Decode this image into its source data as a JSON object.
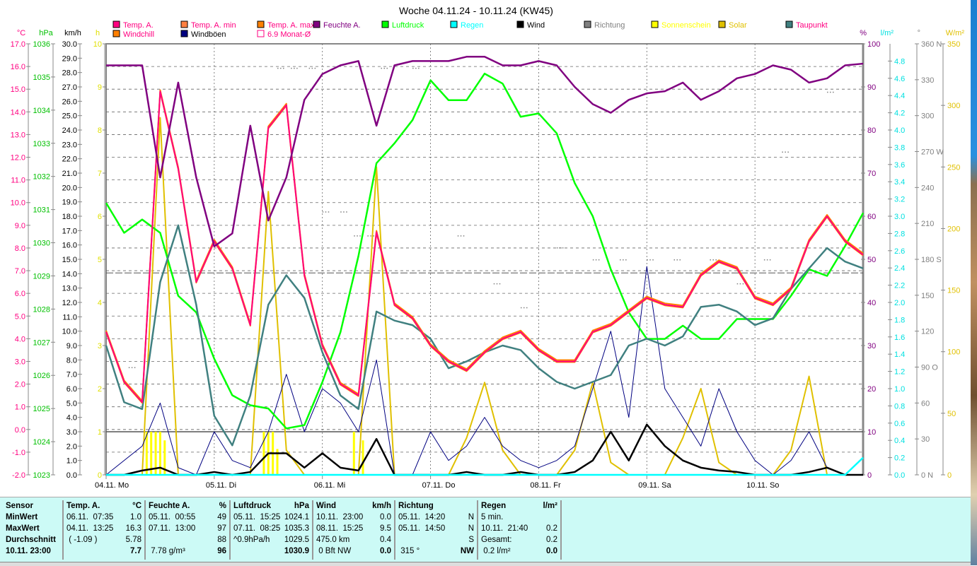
{
  "chart_data": {
    "type": "line",
    "title": "Woche 04.11.24 - 10.11.24 (KW45)",
    "x_unit": "hours since 04.11. 00:00",
    "x": [
      0,
      4,
      8,
      12,
      16,
      20,
      24,
      28,
      32,
      36,
      40,
      44,
      48,
      52,
      56,
      60,
      64,
      68,
      72,
      76,
      80,
      84,
      88,
      92,
      96,
      100,
      104,
      108,
      112,
      116,
      120,
      124,
      128,
      132,
      136,
      140,
      144,
      148,
      152,
      156,
      160,
      164,
      168
    ],
    "day_labels": [
      "04.11. Mo",
      "05.11. Di",
      "06.11. Mi",
      "07.11. Do",
      "08.11. Fr",
      "09.11. Sa",
      "10.11. So"
    ],
    "axes": {
      "temp": {
        "unit": "°C",
        "range": [
          -2,
          17
        ],
        "step": 1
      },
      "pressure": {
        "unit": "hPa",
        "range": [
          1023,
          1036
        ],
        "step": 1
      },
      "wind": {
        "unit": "km/h",
        "range": [
          0,
          30
        ],
        "step": 1
      },
      "sunshine": {
        "unit": "h",
        "range": [
          0,
          10
        ],
        "step": 1
      },
      "humidity": {
        "unit": "%",
        "range": [
          0,
          100
        ],
        "step": 10
      },
      "rain": {
        "unit": "l/m²",
        "range": [
          0,
          5
        ],
        "step": 0.2
      },
      "direction": {
        "unit": "°",
        "range": [
          0,
          360
        ],
        "step": 30,
        "compass": {
          "0": "N",
          "90": "O",
          "180": "S",
          "270": "W",
          "360": "N"
        }
      },
      "solar": {
        "unit": "W/m²",
        "range": [
          0,
          350
        ],
        "step": 50
      }
    },
    "monthly_avg": {
      "label": "6.9 Monat-Ø",
      "value": 6.9
    },
    "series": [
      {
        "name": "Temp. A.",
        "key": "temp",
        "axis": "temp",
        "color": "#ff0080",
        "text": "#ff0080",
        "values": [
          4.3,
          2.1,
          1.2,
          14.9,
          11.5,
          6.5,
          8.3,
          7.1,
          4.6,
          13.3,
          14.3,
          6.8,
          3.7,
          2.0,
          1.5,
          8.7,
          5.5,
          4.9,
          3.7,
          3.0,
          2.6,
          3.4,
          4.0,
          4.3,
          3.5,
          3.0,
          3.0,
          4.3,
          4.6,
          5.2,
          5.8,
          5.5,
          5.4,
          6.8,
          7.4,
          7.1,
          5.8,
          5.5,
          6.2,
          8.3,
          9.4,
          8.3,
          7.7
        ]
      },
      {
        "name": "Windchill",
        "key": "windchill",
        "axis": "temp",
        "color": "#ff8000",
        "text": "#ff0080"
      },
      {
        "name": "Temp. A. min",
        "key": "tmin",
        "axis": "temp",
        "color": "#ff8040",
        "text": "#ff0080"
      },
      {
        "name": "Temp. A. max",
        "key": "tmax",
        "axis": "temp",
        "color": "#ff8000",
        "text": "#ff0080"
      },
      {
        "name": "Feuchte A.",
        "key": "hum",
        "axis": "humidity",
        "color": "#800080",
        "text": "#800080",
        "values": [
          95,
          95,
          95,
          69,
          91,
          69,
          53,
          56,
          81,
          59,
          69,
          87,
          93,
          95,
          96,
          81,
          95,
          96,
          96,
          96,
          97,
          97,
          95,
          95,
          96,
          95,
          90,
          86,
          84,
          87,
          88.5,
          89,
          91,
          87,
          89,
          92,
          93,
          95,
          94,
          91,
          92,
          95,
          95.4
        ]
      },
      {
        "name": "Luftdruck",
        "key": "press",
        "axis": "pressure",
        "color": "#00ff00",
        "text": "#00ff00",
        "values": [
          1031.2,
          1030.3,
          1030.7,
          1030.3,
          1028.4,
          1027.9,
          1026.5,
          1025.4,
          1025.1,
          1025.0,
          1024.4,
          1024.5,
          1025.8,
          1027.3,
          1029.6,
          1032.4,
          1033.0,
          1033.7,
          1034.9,
          1034.3,
          1034.3,
          1035.1,
          1034.8,
          1033.8,
          1033.9,
          1033.3,
          1031.8,
          1030.8,
          1029.2,
          1027.9,
          1027.1,
          1027.1,
          1027.5,
          1027.1,
          1027.1,
          1027.7,
          1027.7,
          1027.7,
          1028.4,
          1029.2,
          1029.0,
          1029.9,
          1030.9
        ]
      },
      {
        "name": "Regen",
        "key": "rain",
        "axis": "rain",
        "color": "#00ffff",
        "text": "#00ffff",
        "values": [
          0,
          0,
          0,
          0,
          0,
          0,
          0,
          0,
          0,
          0,
          0,
          0,
          0,
          0,
          0,
          0,
          0,
          0,
          0,
          0,
          0,
          0,
          0,
          0,
          0,
          0,
          0,
          0,
          0,
          0,
          0,
          0,
          0,
          0,
          0,
          0,
          0,
          0,
          0,
          0,
          0,
          0,
          0.2
        ]
      },
      {
        "name": "Wind",
        "key": "wind",
        "axis": "wind",
        "color": "#000000",
        "text": "#000000",
        "values": [
          0,
          0,
          0.3,
          0.5,
          0,
          0,
          0.2,
          0,
          0.2,
          1.5,
          1.5,
          0.5,
          1.5,
          0.5,
          0.3,
          2.5,
          0,
          0,
          0,
          0,
          0.2,
          0,
          0,
          0.2,
          0,
          0,
          0.2,
          1,
          3,
          1,
          3.5,
          2,
          1,
          0.5,
          0.3,
          0.2,
          0,
          0,
          0,
          0.2,
          0.5,
          0,
          0
        ]
      },
      {
        "name": "Windböen",
        "key": "gust",
        "axis": "wind",
        "color": "#000080",
        "text": "#000000",
        "values": [
          0,
          1,
          2,
          5,
          0.5,
          0,
          3,
          1,
          0.5,
          3,
          7,
          3,
          6,
          5,
          3,
          8,
          0,
          0,
          3,
          1,
          2,
          4,
          2,
          1,
          0.5,
          1,
          2,
          6,
          10,
          4,
          14.5,
          6,
          4,
          2,
          6,
          3,
          1,
          0,
          1,
          3,
          0.5,
          0,
          0
        ]
      },
      {
        "name": "Richtung",
        "key": "dir",
        "axis": "direction",
        "color": "#808080",
        "text": "#808080",
        "points": [
          [
            38,
            340
          ],
          [
            41,
            340
          ],
          [
            45,
            340
          ],
          [
            48,
            220
          ],
          [
            52,
            220
          ],
          [
            55,
            200
          ],
          [
            58,
            200
          ],
          [
            61,
            340
          ],
          [
            68,
            340
          ],
          [
            78,
            200
          ],
          [
            86,
            160
          ],
          [
            92,
            140
          ],
          [
            100,
            190
          ],
          [
            108,
            180
          ],
          [
            114,
            180
          ],
          [
            120,
            180
          ],
          [
            126,
            180
          ],
          [
            134,
            180
          ],
          [
            140,
            160
          ],
          [
            146,
            180
          ],
          [
            150,
            270
          ],
          [
            160,
            320
          ],
          [
            5,
            90
          ]
        ]
      },
      {
        "name": "Sonnenschein",
        "key": "sun",
        "axis": "sunshine",
        "color": "#ffff00",
        "text": "#ffff00",
        "points": [
          [
            9,
            1
          ],
          [
            10,
            1
          ],
          [
            11,
            1
          ],
          [
            12,
            1
          ],
          [
            13,
            0.8
          ],
          [
            35,
            1
          ],
          [
            36,
            1
          ],
          [
            37,
            1
          ],
          [
            38,
            0.6
          ],
          [
            55,
            1
          ],
          [
            57,
            0.8
          ]
        ]
      },
      {
        "name": "Solar",
        "key": "solar",
        "axis": "solar",
        "color": "#e0c000",
        "text": "#e0c000",
        "values": [
          0,
          0,
          0,
          290,
          0,
          0,
          0,
          0,
          0,
          230,
          20,
          0,
          0,
          0,
          0,
          250,
          0,
          0,
          0,
          0,
          30,
          75,
          20,
          0,
          0,
          0,
          20,
          75,
          10,
          0,
          0,
          0,
          30,
          70,
          10,
          0,
          0,
          0,
          20,
          80,
          0,
          0,
          0
        ]
      },
      {
        "name": "Taupunkt",
        "key": "dew",
        "axis": "temp",
        "color": "#408080",
        "text": "#ff0080",
        "values": [
          3.7,
          1.2,
          0.9,
          6.5,
          9.0,
          5.5,
          0.6,
          -0.7,
          1.5,
          5.5,
          6.8,
          5.8,
          3.4,
          1.5,
          0.9,
          5.2,
          4.8,
          4.6,
          4.0,
          2.7,
          3.0,
          3.4,
          3.7,
          3.5,
          2.7,
          2.1,
          1.8,
          2.1,
          2.4,
          3.7,
          4.0,
          3.7,
          4.1,
          5.4,
          5.5,
          5.2,
          4.6,
          4.9,
          6.2,
          7.1,
          8.0,
          7.4,
          7.1
        ]
      }
    ]
  },
  "table": {
    "columns": [
      {
        "rows": [
          [
            "Sensor",
            ""
          ],
          [
            "MinWert",
            ""
          ],
          [
            "MaxWert",
            ""
          ],
          [
            "Durchschnitt",
            ""
          ],
          [
            "10.11. 23:00",
            ""
          ]
        ]
      },
      {
        "rows": [
          [
            "Temp. A.",
            "°C"
          ],
          [
            "06.11.  07:35",
            "1.0"
          ],
          [
            "04.11.  13:25",
            "16.3"
          ],
          [
            " ( -1.09 )",
            "5.78"
          ],
          [
            "",
            "7.7"
          ]
        ]
      },
      {
        "rows": [
          [
            "Feuchte A.",
            "%"
          ],
          [
            "05.11.  00:55",
            "49"
          ],
          [
            "07.11.  13:00",
            "97"
          ],
          [
            "",
            "88"
          ],
          [
            " 7.78 g/m³",
            "96"
          ]
        ]
      },
      {
        "rows": [
          [
            "Luftdruck",
            "hPa"
          ],
          [
            "05.11.  15:25",
            "1024.1"
          ],
          [
            "07.11.  08:25",
            "1035.3"
          ],
          [
            "^0.9hPa/h",
            "1029.5"
          ],
          [
            "",
            "1030.9"
          ]
        ]
      },
      {
        "rows": [
          [
            "Wind",
            "km/h"
          ],
          [
            "10.11.  23:00",
            "0.0"
          ],
          [
            "08.11.  15:25",
            "9.5"
          ],
          [
            "475.0 km",
            "0.4"
          ],
          [
            " 0 Bft NW",
            "0.0"
          ]
        ]
      },
      {
        "rows": [
          [
            "Richtung",
            ""
          ],
          [
            "05.11.  14:20",
            "N"
          ],
          [
            "05.11.  14:50",
            "N"
          ],
          [
            "",
            "S"
          ],
          [
            " 315 °",
            "NW"
          ]
        ]
      },
      {
        "rows": [
          [
            "Regen",
            "l/m²"
          ],
          [
            "5 min.",
            ""
          ],
          [
            "10.11.  21:40",
            "0.2"
          ],
          [
            "Gesamt:",
            "0.2"
          ],
          [
            " 0.2 l/m²",
            "0.0"
          ]
        ]
      }
    ]
  }
}
